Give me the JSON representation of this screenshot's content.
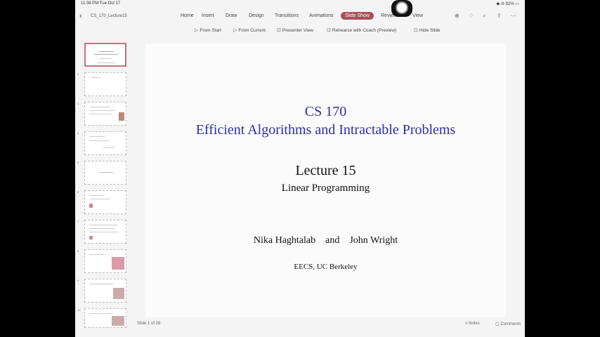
{
  "status": {
    "time": "11:38 PM  Tue Oct 17",
    "right": "◆ ⊜ 92% ▭"
  },
  "document": {
    "name": "CS_170_Lecture15"
  },
  "tabs": [
    "Home",
    "Insert",
    "Draw",
    "Design",
    "Transitions",
    "Animations",
    "Slide Show",
    "Review",
    "View"
  ],
  "active_tab": "Slide Show",
  "ribbon": [
    {
      "icon": "▷",
      "label": "From Start"
    },
    {
      "icon": "▷",
      "label": "From Current"
    },
    {
      "icon": "⊡",
      "label": "Presenter View"
    },
    {
      "icon": "⊡",
      "label": "Rehearse with Coach (Preview)"
    },
    {
      "icon": "⊡",
      "label": "Hide Slide"
    }
  ],
  "thumbnails": [
    "1",
    "2",
    "3",
    "4",
    "5",
    "6",
    "7",
    "8",
    "9",
    "10",
    "11"
  ],
  "slide": {
    "title_line1": "CS 170",
    "title_line2": "Efficient Algorithms and Intractable Problems",
    "lecture": "Lecture 15",
    "subtitle": "Linear Programming",
    "authors": "Nika Haghtalab    and    John Wright",
    "affiliation": "EECS, UC Berkeley"
  },
  "footer": {
    "slide_count": "Slide 1 of 28",
    "notes": "Notes",
    "comments": "Comments"
  },
  "colors": {
    "accent": "#a8505a",
    "title_blue": "#2d2dad"
  }
}
